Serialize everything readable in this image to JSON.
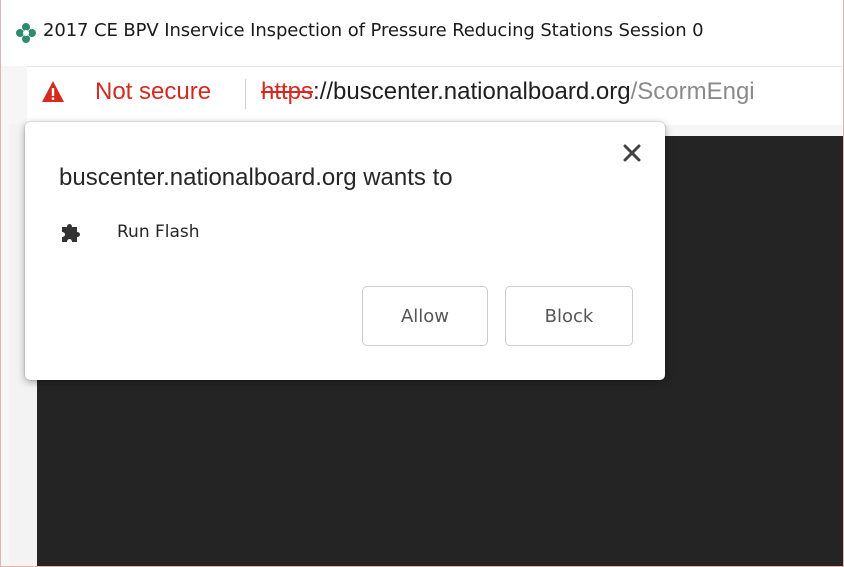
{
  "window": {
    "title": "2017 CE BPV Inservice Inspection of Pressure Reducing Stations Session 0"
  },
  "address_bar": {
    "security_label": "Not secure",
    "url_scheme": "https",
    "url_host": "://buscenter.nationalboard.org",
    "url_path": "/ScormEngi"
  },
  "permission_prompt": {
    "heading": "buscenter.nationalboard.org wants to",
    "permission": "Run Flash",
    "allow_label": "Allow",
    "block_label": "Block",
    "close_symbol": "✕"
  },
  "icons": {
    "favicon": "site-favicon-icon",
    "warning": "warning-triangle-icon",
    "plugin": "puzzle-piece-icon",
    "close": "close-icon"
  },
  "colors": {
    "insecure_red": "#d42a20",
    "page_background": "#242424",
    "favicon_green": "#2e8b6e"
  }
}
